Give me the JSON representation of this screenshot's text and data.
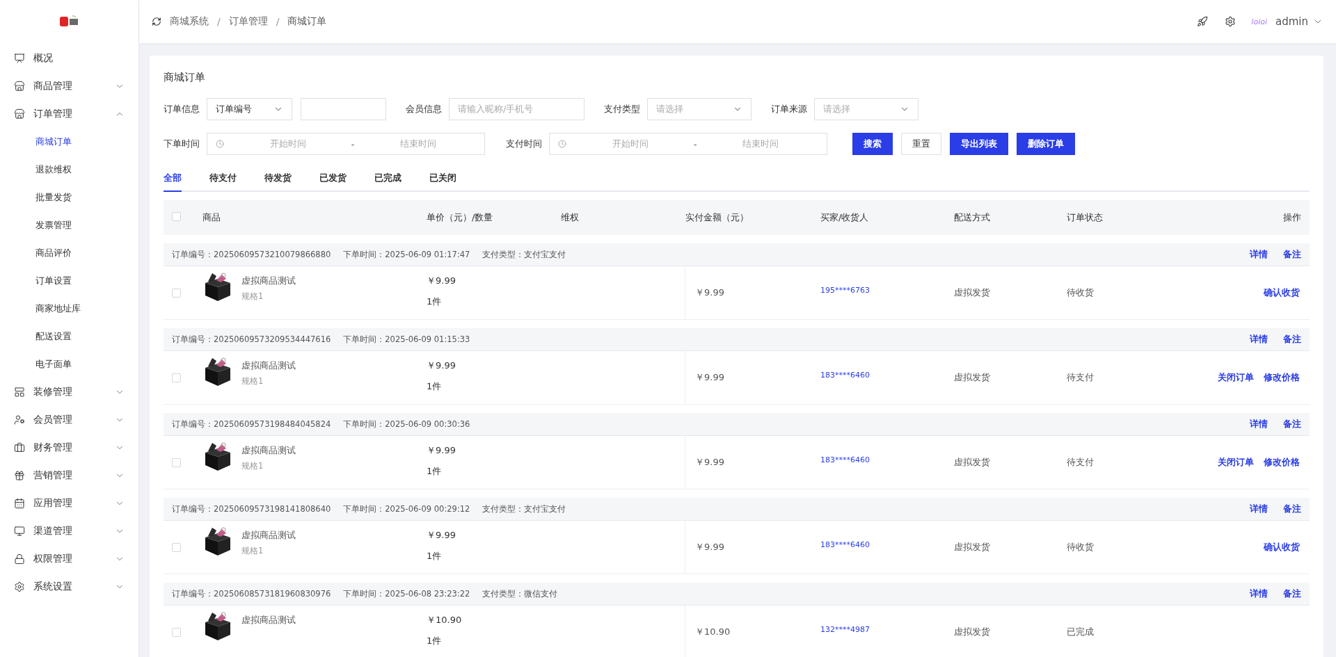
{
  "sidebar": {
    "items": [
      {
        "label": "概况"
      },
      {
        "label": "商品管理",
        "expanded": false
      },
      {
        "label": "订单管理",
        "expanded": true,
        "children": [
          {
            "label": "商城订单",
            "selected": true
          },
          {
            "label": "退款维权",
            "selected": false
          },
          {
            "label": "批量发货",
            "selected": false
          },
          {
            "label": "发票管理",
            "selected": false
          },
          {
            "label": "商品评价",
            "selected": false
          },
          {
            "label": "订单设置",
            "selected": false
          },
          {
            "label": "商家地址库",
            "selected": false
          },
          {
            "label": "配送设置",
            "selected": false
          },
          {
            "label": "电子面单",
            "selected": false
          }
        ]
      },
      {
        "label": "装修管理",
        "expanded": false
      },
      {
        "label": "会员管理",
        "expanded": false
      },
      {
        "label": "财务管理",
        "expanded": false
      },
      {
        "label": "营销管理",
        "expanded": false
      },
      {
        "label": "应用管理",
        "expanded": false
      },
      {
        "label": "渠道管理",
        "expanded": false
      },
      {
        "label": "权限管理",
        "expanded": false
      },
      {
        "label": "系统设置",
        "expanded": false
      }
    ]
  },
  "header": {
    "breadcrumbs": [
      "商城系统",
      "订单管理",
      "商城订单"
    ],
    "separator": "/",
    "badge_text": "loioi",
    "user": "admin"
  },
  "page": {
    "title": "商城订单",
    "filters": [
      {
        "label": "订单信息",
        "kind": "select-input",
        "value": "订单编号"
      },
      {
        "label": "会员信息",
        "kind": "input",
        "placeholder": "请输入昵称/手机号"
      },
      {
        "label": "支付类型",
        "kind": "select",
        "placeholder": "请选择"
      },
      {
        "label": "订单来源",
        "kind": "select",
        "placeholder": "请选择"
      }
    ],
    "date_filters": [
      {
        "label": "下单时间",
        "start_placeholder": "开始时间",
        "dash": "-",
        "end_placeholder": "结束时间"
      },
      {
        "label": "支付时间",
        "start_placeholder": "开始时间",
        "dash": "-",
        "end_placeholder": "结束时间"
      }
    ],
    "buttons": [
      {
        "label": "搜索",
        "kind": "primary"
      },
      {
        "label": "重置",
        "kind": "default"
      },
      {
        "label": "导出列表",
        "kind": "primary"
      },
      {
        "label": "删除订单",
        "kind": "primary"
      }
    ],
    "tabs": [
      {
        "label": "全部",
        "selected": true
      },
      {
        "label": "待支付",
        "selected": false
      },
      {
        "label": "待发货",
        "selected": false
      },
      {
        "label": "已发货",
        "selected": false
      },
      {
        "label": "已完成",
        "selected": false
      },
      {
        "label": "已关闭",
        "selected": false
      }
    ],
    "table": {
      "all_checked": false,
      "columns": [
        "商品",
        "单价（元）/数量",
        "维权",
        "实付金额（元）",
        "买家/收货人",
        "配送方式",
        "订单状态",
        "操作"
      ],
      "orders": [
        {
          "checked": false,
          "number": "订单编号：20250609573210079866880",
          "time": "下单时间：2025-06-09 01:17:47",
          "pay_type": "支付类型：支付宝支付",
          "links": [
            "详情",
            "备注"
          ],
          "product": "虚拟商品测试",
          "spec": "规格1",
          "price": "￥9.99",
          "qty": "1件",
          "paid": "￥9.99",
          "buyer": "195****6763",
          "shipping": "虚拟发货",
          "status": "待收货",
          "actions": [
            "确认收货"
          ]
        },
        {
          "checked": false,
          "number": "订单编号：20250609573209534447616",
          "time": "下单时间：2025-06-09 01:15:33",
          "links": [
            "详情",
            "备注"
          ],
          "product": "虚拟商品测试",
          "spec": "规格1",
          "price": "￥9.99",
          "qty": "1件",
          "paid": "￥9.99",
          "buyer": "183****6460",
          "shipping": "虚拟发货",
          "status": "待支付",
          "actions": [
            "关闭订单",
            "修改价格"
          ]
        },
        {
          "checked": false,
          "number": "订单编号：20250609573198484045824",
          "time": "下单时间：2025-06-09 00:30:36",
          "links": [
            "详情",
            "备注"
          ],
          "product": "虚拟商品测试",
          "spec": "规格1",
          "price": "￥9.99",
          "qty": "1件",
          "paid": "￥9.99",
          "buyer": "183****6460",
          "shipping": "虚拟发货",
          "status": "待支付",
          "actions": [
            "关闭订单",
            "修改价格"
          ]
        },
        {
          "checked": false,
          "number": "订单编号：20250609573198141808640",
          "time": "下单时间：2025-06-09 00:29:12",
          "pay_type": "支付类型：支付宝支付",
          "links": [
            "详情",
            "备注"
          ],
          "product": "虚拟商品测试",
          "spec": "规格1",
          "price": "￥9.99",
          "qty": "1件",
          "paid": "￥9.99",
          "buyer": "183****6460",
          "shipping": "虚拟发货",
          "status": "待收货",
          "actions": [
            "确认收货"
          ]
        },
        {
          "checked": false,
          "number": "订单编号：20250608573181960830976",
          "time": "下单时间：2025-06-08 23:23:22",
          "pay_type": "支付类型：微信支付",
          "links": [
            "详情",
            "备注"
          ],
          "product": "虚拟商品测试",
          "price": "￥10.90",
          "qty": "1件",
          "paid": "￥10.90",
          "buyer": "132****4987",
          "shipping": "虚拟发货",
          "status": "已完成"
        }
      ]
    }
  }
}
